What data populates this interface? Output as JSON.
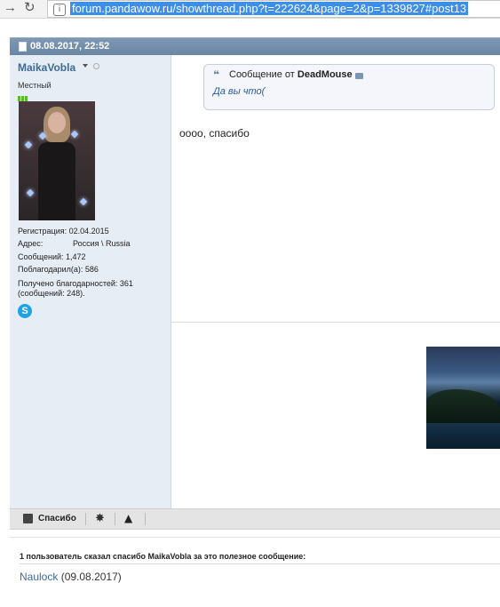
{
  "browser": {
    "url": "forum.pandawow.ru/showthread.php?t=222624&page=2&p=1339827#post13"
  },
  "post": {
    "date": "08.08.2017, 22:52"
  },
  "user": {
    "name": "MaikaVobla",
    "title": "Местный",
    "registration": "Регистрация:   02.04.2015",
    "address_label": "Адрес:",
    "address_value": "Россия \\ Russia",
    "messages": "Сообщений:   1,472",
    "thanked": "Поблагодарил(а):   586",
    "received_1": "Получено благодарностей: 361",
    "received_2": "(сообщений: 248)."
  },
  "message": {
    "quote_prefix": "Сообщение от",
    "quote_author": "DeadMouse",
    "quote_text": "Да вы что(",
    "body": "оооо, спасибо"
  },
  "actions": {
    "thanks_label": "Спасибо"
  },
  "thanks": {
    "title": "1 пользователь сказал спасибо MaikaVobla за это полезное сообщение:",
    "user": "Naulock",
    "date": "(09.08.2017)"
  },
  "colors": {
    "header_bar": "#6a86a3",
    "username": "#3e6a96",
    "user_col_bg": "#e6edf5",
    "url_highlight": "#3d8ee8"
  },
  "icons": [
    "forward-icon",
    "reload-icon",
    "lock-icon",
    "document-icon",
    "quote-icon",
    "view-post-icon",
    "skype-icon",
    "thanks-icon",
    "star-icon",
    "warning-icon"
  ]
}
